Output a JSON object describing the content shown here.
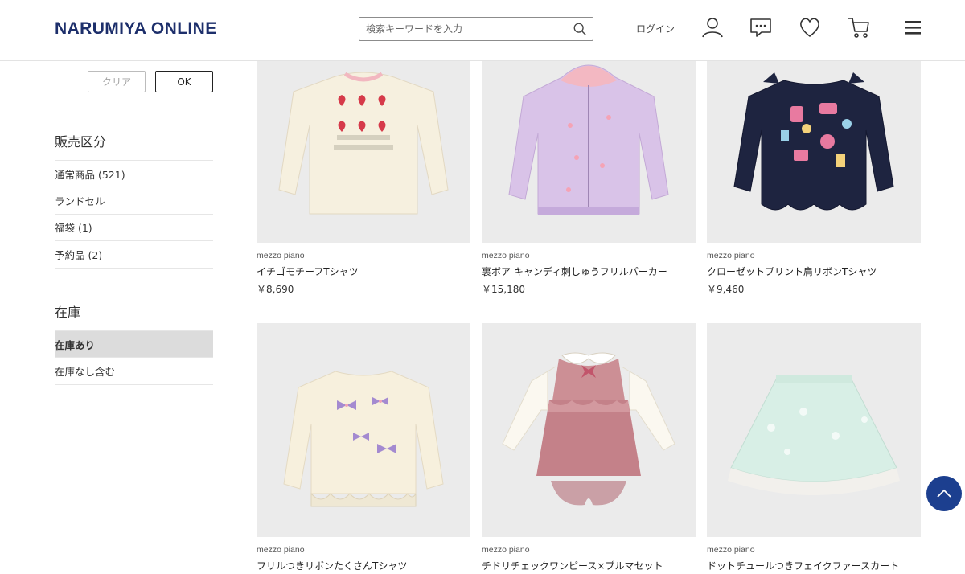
{
  "header": {
    "logo": "NARUMIYA ONLINE",
    "search_placeholder": "検索キーワードを入力",
    "login_label": "ログイン",
    "icons": [
      "user-icon",
      "chat-icon",
      "heart-icon",
      "cart-icon",
      "menu-icon"
    ]
  },
  "sidebar": {
    "clear_label": "クリア",
    "ok_label": "OK",
    "sales_title": "販売区分",
    "sales_items": [
      "通常商品 (521)",
      "ランドセル",
      "福袋 (1)",
      "予約品 (2)"
    ],
    "stock_title": "在庫",
    "stock_items": [
      "在庫あり",
      "在庫なし含む"
    ],
    "stock_selected": "在庫あり"
  },
  "products": [
    {
      "brand": "mezzo piano",
      "name": "イチゴモチーフTシャツ",
      "price": "￥8,690",
      "image": "cream-strawberry-tshirt"
    },
    {
      "brand": "mezzo piano",
      "name": "裏ボア キャンディ刺しゅうフリルパーカー",
      "price": "￥15,180",
      "image": "lilac-zip-hoodie"
    },
    {
      "brand": "mezzo piano",
      "name": "クローゼットプリント肩リボンTシャツ",
      "price": "￥9,460",
      "image": "navy-closet-print-tshirt"
    },
    {
      "brand": "mezzo piano",
      "name": "フリルつきリボンたくさんTシャツ",
      "price": "",
      "image": "cream-ribbon-tshirt"
    },
    {
      "brand": "mezzo piano",
      "name": "チドリチェックワンピース×ブルマセット",
      "price": "",
      "image": "pink-check-dress-set"
    },
    {
      "brand": "mezzo piano",
      "name": "ドットチュールつきフェイクファースカート",
      "price": "",
      "image": "mint-fur-skirt"
    }
  ],
  "colors": {
    "brand_navy": "#1d2f6b",
    "scroll_button": "#1c3f8f",
    "selected_bg": "#dcdcdc"
  },
  "scroll_top_icon": "chevron-up-icon"
}
